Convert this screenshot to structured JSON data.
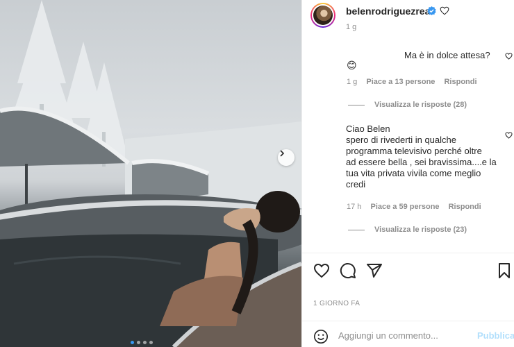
{
  "post": {
    "username": "belenrodriguezreal",
    "time": "1 g",
    "date_label": "1 GIORNO FA"
  },
  "comments": [
    {
      "text": "Ma è in dolce attesa?",
      "emoji": "😊",
      "time": "1 g",
      "likes": "Piace a 13 persone",
      "reply": "Rispondi",
      "view_replies": "Visualizza le risposte (28)"
    },
    {
      "text": "Ciao Belen\nspero di rivederti in qualche\nprogramma televisivo perché oltre\nad essere bella , sei bravissima....e la\ntua vita privata vivila come meglio\ncredi",
      "time": "17 h",
      "likes": "Piace a 59 persone",
      "reply": "Rispondi",
      "view_replies": "Visualizza le risposte (23)"
    }
  ],
  "composer": {
    "placeholder": "Aggiungi un commento...",
    "publish_label": "Pubblica"
  },
  "carousel": {
    "slides": 4,
    "active_index": 0
  },
  "icons": {
    "verified": "verified-badge-icon",
    "like": "heart-icon",
    "comment": "comment-bubble-icon",
    "share": "paper-plane-icon",
    "save": "bookmark-icon",
    "emoji": "smiley-icon",
    "next": "chevron-right-icon"
  },
  "colors": {
    "verified": "#3897f0",
    "publish_disabled": "#b2dffc",
    "muted_text": "#8e8e8e",
    "active_dot": "#3897f0"
  }
}
